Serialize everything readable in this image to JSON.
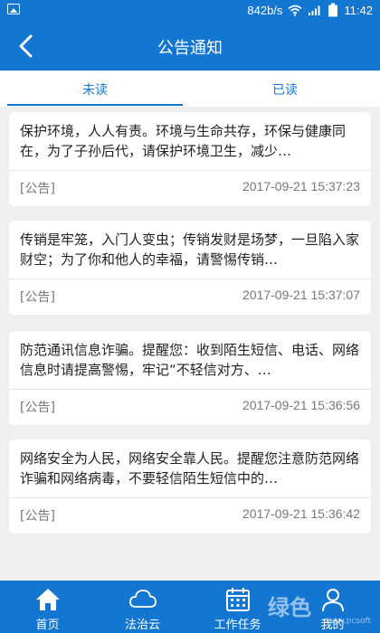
{
  "status_bar": {
    "network_speed": "842b/s",
    "time": "11:42",
    "icons": [
      "image-icon",
      "wifi-icon",
      "signal-icon",
      "battery-icon"
    ]
  },
  "header": {
    "title": "公告通知",
    "back_icon": "chevron-left-icon"
  },
  "tabs": [
    {
      "label": "未读",
      "active": true
    },
    {
      "label": "已读",
      "active": false
    }
  ],
  "notices": [
    {
      "text": "保护环境，人人有责。环境与生命共存，环保与健康同在，为了子孙后代，请保护环境卫生，减少…",
      "tag": "[公告]",
      "time": "2017-09-21 15:37:23"
    },
    {
      "text": "传销是牢笼，入门人变虫；传销发财是场梦，一旦陷入家财空；为了你和他人的幸福，请警惕传销…",
      "tag": "[公告]",
      "time": "2017-09-21 15:37:07"
    },
    {
      "text": "防范通讯信息诈骗。提醒您：收到陌生短信、电话、网络信息时请提高警惕，牢记“不轻信对方、…",
      "tag": "[公告]",
      "time": "2017-09-21 15:36:56"
    },
    {
      "text": "网络安全为人民，网络安全靠人民。提醒您注意防范网络诈骗和网络病毒，不要轻信陌生短信中的…",
      "tag": "[公告]",
      "time": "2017-09-21 15:36:42"
    }
  ],
  "bottom_nav": [
    {
      "label": "首页",
      "icon": "home-icon"
    },
    {
      "label": "法治云",
      "icon": "cloud-icon"
    },
    {
      "label": "工作任务",
      "icon": "calendar-icon"
    },
    {
      "label": "我的",
      "icon": "person-icon"
    }
  ],
  "watermark": {
    "text": "绿色",
    "sub": "www.pcsoft"
  },
  "colors": {
    "primary": "#1376d0",
    "background": "#efefef",
    "card": "#ffffff",
    "muted_text": "#777777"
  }
}
